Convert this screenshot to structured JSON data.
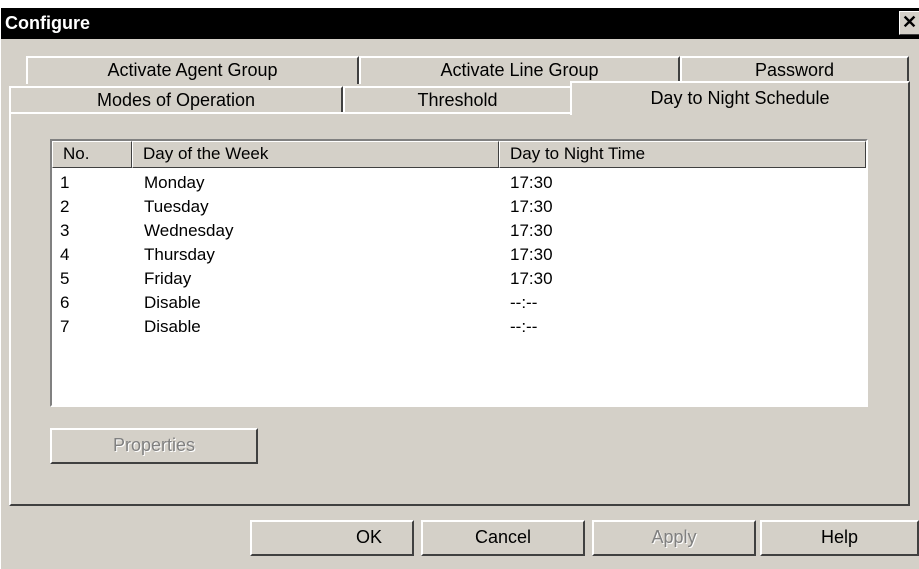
{
  "window": {
    "title": "Configure",
    "close_glyph": "✕"
  },
  "tabs": {
    "row1": [
      "Activate Agent Group",
      "Activate Line Group",
      "Password"
    ],
    "row2": [
      "Modes of Operation",
      "Threshold",
      "Day to Night Schedule"
    ],
    "selected": "Day to Night Schedule"
  },
  "list": {
    "columns": [
      "No.",
      "Day of the Week",
      "Day to Night Time"
    ],
    "rows": [
      [
        "1",
        "Monday",
        "17:30"
      ],
      [
        "2",
        "Tuesday",
        "17:30"
      ],
      [
        "3",
        "Wednesday",
        "17:30"
      ],
      [
        "4",
        "Thursday",
        "17:30"
      ],
      [
        "5",
        "Friday",
        "17:30"
      ],
      [
        "6",
        "Disable",
        "--:--"
      ],
      [
        "7",
        "Disable",
        "--:--"
      ]
    ]
  },
  "buttons": {
    "properties": "Properties",
    "ok": "OK",
    "cancel": "Cancel",
    "apply": "Apply",
    "help": "Help"
  }
}
